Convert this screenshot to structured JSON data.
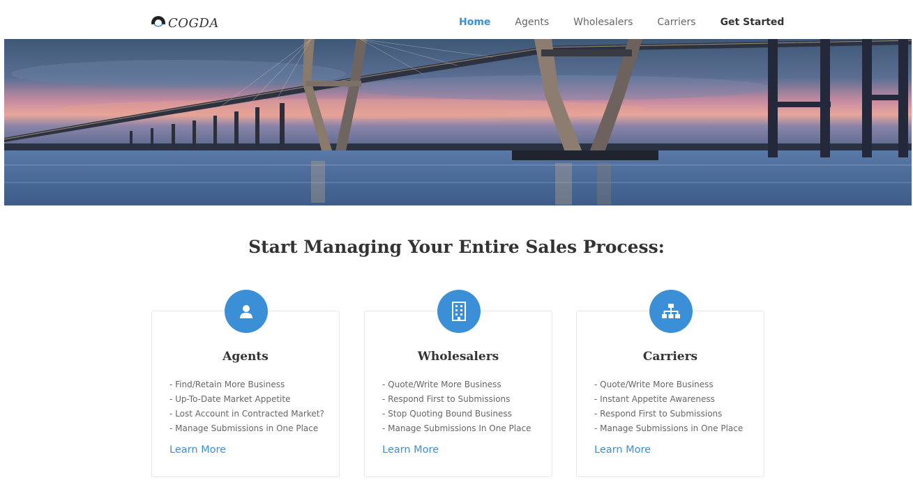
{
  "brand": {
    "name": "COGDA",
    "accent": "#3b8fd6"
  },
  "nav": {
    "items": [
      {
        "label": "Home"
      },
      {
        "label": "Agents"
      },
      {
        "label": "Wholesalers"
      },
      {
        "label": "Carriers"
      },
      {
        "label": "Get Started"
      }
    ]
  },
  "hero": {
    "alt": "bridge-over-water-at-dusk"
  },
  "headline": "Start Managing Your Entire Sales Process:",
  "cards": [
    {
      "icon": "user-icon",
      "title": "Agents",
      "items": [
        "- Find/Retain More Business",
        "- Up-To-Date Market Appetite",
        "- Lost Account in Contracted Market?",
        "- Manage Submissions in One Place"
      ],
      "link": "Learn More"
    },
    {
      "icon": "building-icon",
      "title": "Wholesalers",
      "items": [
        "- Quote/Write More Business",
        "- Respond First to Submissions",
        "- Stop Quoting Bound Business",
        "- Manage Submissions In One Place"
      ],
      "link": "Learn More"
    },
    {
      "icon": "org-chart-icon",
      "title": "Carriers",
      "items": [
        "- Quote/Write More Business",
        "- Instant Appetite Awareness",
        "- Respond First to Submissions",
        "- Manage Submissions in One Place"
      ],
      "link": "Learn More"
    }
  ]
}
